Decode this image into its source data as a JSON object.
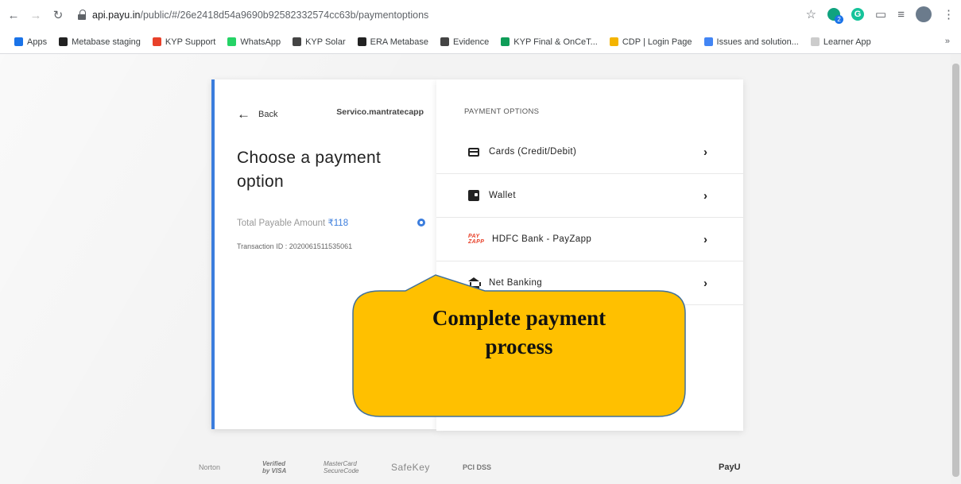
{
  "browser": {
    "url_host": "api.payu.in",
    "url_path": "/public/#/26e2418d54a9690b92582332574cc63b/paymentoptions",
    "ext_badge": "2",
    "ext_green_letter": "G",
    "bookmarks": [
      {
        "label": "Apps",
        "color": "#1a73e8"
      },
      {
        "label": "Metabase staging",
        "color": "#222222"
      },
      {
        "label": "KYP Support",
        "color": "#e8412a"
      },
      {
        "label": "WhatsApp",
        "color": "#25d366"
      },
      {
        "label": "KYP Solar",
        "color": "#444444"
      },
      {
        "label": "ERA Metabase",
        "color": "#222222"
      },
      {
        "label": "Evidence",
        "color": "#444444"
      },
      {
        "label": "KYP Final & OnCeT...",
        "color": "#0f9d58"
      },
      {
        "label": "CDP | Login Page",
        "color": "#f4b400"
      },
      {
        "label": "Issues and solution...",
        "color": "#4285f4"
      },
      {
        "label": "Learner App",
        "color": "#cccccc"
      }
    ],
    "bookmarks_more": "»"
  },
  "checkout": {
    "back_label": "Back",
    "merchant": "Servico.mantratecapp",
    "title": "Choose a payment option",
    "total_label": "Total Payable Amount",
    "total_amount": "₹118",
    "transaction_id": "Transaction ID : 2020061511535061",
    "options_heading": "PAYMENT OPTIONS",
    "options": [
      {
        "label": "Cards (Credit/Debit)",
        "icon": "card-icon"
      },
      {
        "label": "Wallet",
        "icon": "wallet-icon"
      },
      {
        "label": "HDFC Bank - PayZapp",
        "icon": "payzapp-icon"
      },
      {
        "label": "Net Banking",
        "icon": "bank-icon"
      }
    ],
    "accent_color": "#3b7ddd"
  },
  "footer": {
    "logos": [
      "Norton",
      "Verified by VISA",
      "MasterCard SecureCode",
      "SafeKey",
      "PCI DSS"
    ],
    "brand": "PayU"
  },
  "callout": {
    "line1": "Complete payment",
    "line2": "process",
    "fill": "#ffc000",
    "stroke": "#41719c"
  }
}
